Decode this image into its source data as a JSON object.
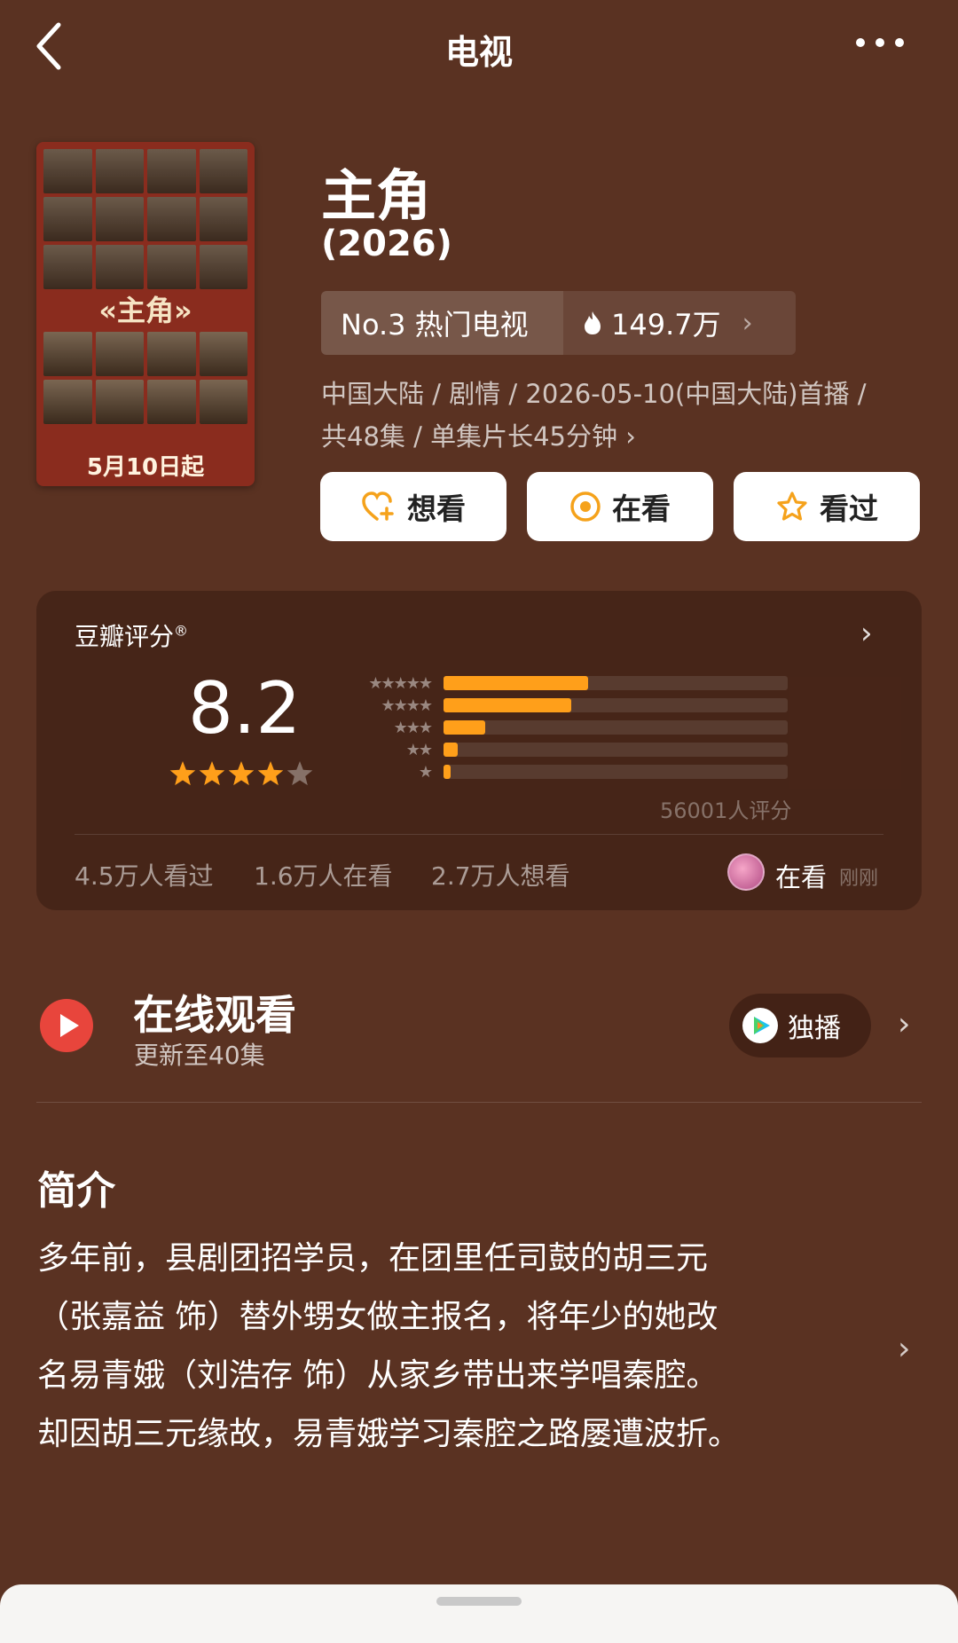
{
  "header": {
    "title": "电视"
  },
  "poster": {
    "logo_text": "«主角»",
    "date_text": "5月10日起"
  },
  "show": {
    "title": "主角",
    "year": "(2026)",
    "rank_label": "No.3 热门电视",
    "heat_value": "149.7万",
    "meta_line1": "中国大陆 / 剧情 / 2026-05-10(中国大陆)首播 /",
    "meta_line2": "共48集 / 单集片长45分钟 ›"
  },
  "actions": {
    "want": "想看",
    "watching": "在看",
    "watched": "看过"
  },
  "rating": {
    "label": "豆瓣评分",
    "score": "8.2",
    "star_value": 4.1,
    "distribution": [
      0.42,
      0.37,
      0.12,
      0.04,
      0.02
    ],
    "count_text": "56001人评分",
    "watched_count": "4.5万人看过",
    "watching_count": "1.6万人在看",
    "want_count": "2.7万人想看",
    "friend_status": "在看",
    "friend_time": "刚刚"
  },
  "online": {
    "title": "在线观看",
    "subtitle": "更新至40集",
    "exclusive_label": "独播"
  },
  "synopsis": {
    "title": "简介",
    "lines": [
      "多年前，县剧团招学员，在团里任司鼓的胡三元",
      "（张嘉益 饰）替外甥女做主报名，将年少的她改",
      "名易青娥（刘浩存 饰）从家乡带出来学唱秦腔。",
      "却因胡三元缘故，易青娥学习秦腔之路屡遭波折。"
    ]
  },
  "colors": {
    "background": "#5a3222",
    "accent": "#ff9f1a",
    "play_red": "#e8453c"
  }
}
